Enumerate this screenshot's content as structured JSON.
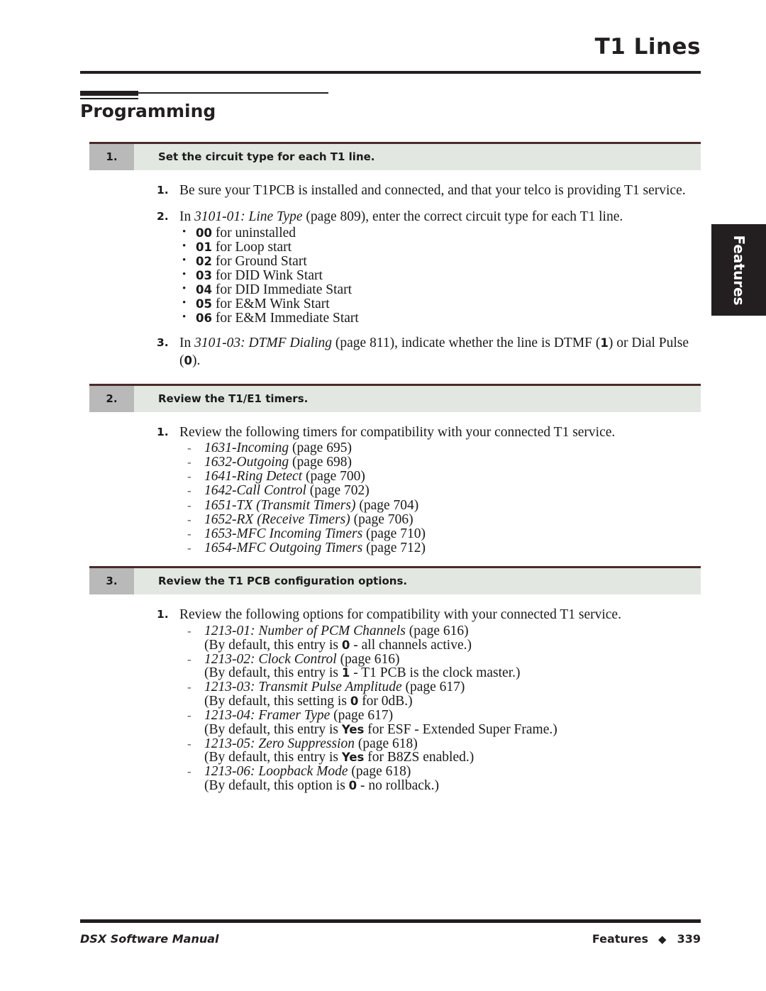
{
  "header": {
    "title": "T1 Lines"
  },
  "section_heading": {
    "title": "Programming"
  },
  "side_tab": {
    "label": "Features"
  },
  "steps": [
    {
      "number": "1.",
      "title": "Set the circuit type for each T1 line.",
      "substeps": [
        {
          "marker": "1.",
          "text": "Be sure your T1PCB is installed and connected, and that your telco is providing T1 service."
        },
        {
          "marker": "2.",
          "text_pre": "In ",
          "text_italic": "3101-01: Line Type",
          "text_post": " (page 809), enter the correct circuit type for each T1 line.",
          "bullets": [
            {
              "code": "00",
              "text": " for uninstalled"
            },
            {
              "code": "01",
              "text": " for Loop start"
            },
            {
              "code": "02",
              "text": " for Ground Start"
            },
            {
              "code": "03",
              "text": " for DID Wink Start"
            },
            {
              "code": "04",
              "text": " for DID Immediate Start"
            },
            {
              "code": "05",
              "text": " for E&M Wink Start"
            },
            {
              "code": "06",
              "text": " for E&M Immediate Start"
            }
          ]
        },
        {
          "marker": "3.",
          "text_pre": "In ",
          "text_italic": "3101-03: DTMF Dialing",
          "text_mid": " (page 811), indicate whether the line is DTMF (",
          "code_a": "1",
          "text_mid2": ") or Dial Pulse (",
          "code_b": "0",
          "text_post": ")."
        }
      ]
    },
    {
      "number": "2.",
      "title": "Review the T1/E1 timers.",
      "substeps": [
        {
          "marker": "1.",
          "text": "Review the following timers for compatibility with your connected T1 service.",
          "dashes": [
            {
              "italic": "1631-Incoming",
              "plain": " (page 695)"
            },
            {
              "italic": "1632-Outgoing",
              "plain": " (page 698)"
            },
            {
              "italic": "1641-Ring Detect",
              "plain": " (page 700)"
            },
            {
              "italic": "1642-Call Control",
              "plain": " (page 702)"
            },
            {
              "italic": "1651-TX (Transmit Timers)",
              "plain": " (page 704)"
            },
            {
              "italic": "1652-RX (Receive Timers)",
              "plain": " (page 706)"
            },
            {
              "italic": "1653-MFC Incoming Timers",
              "plain": " (page 710)"
            },
            {
              "italic": "1654-MFC Outgoing Timers",
              "plain": " (page 712)"
            }
          ]
        }
      ]
    },
    {
      "number": "3.",
      "title": "Review the T1 PCB configuration options.",
      "substeps": [
        {
          "marker": "1.",
          "text": "Review the following options for compatibility with your connected T1 service.",
          "dashes": [
            {
              "italic": "1213-01: Number of PCM Channels",
              "plain": " (page 616)",
              "note_pre": "(By default, this entry is ",
              "note_code": "0",
              "note_post": " - all channels active.)"
            },
            {
              "italic": "1213-02: Clock Control",
              "plain": " (page 616)",
              "note_pre": "(By default, this entry is ",
              "note_code": "1",
              "note_post": " - T1 PCB is the clock master.)"
            },
            {
              "italic": "1213-03: Transmit Pulse Amplitude",
              "plain": " (page 617)",
              "note_pre": "(By default, this setting is ",
              "note_code": "0",
              "note_post": " for 0dB.)"
            },
            {
              "italic": "1213-04: Framer Type",
              "plain": " (page 617)",
              "note_pre": "(By default, this entry is ",
              "note_code": "Yes",
              "note_post": " for ESF - Extended Super Frame.)"
            },
            {
              "italic": "1213-05: Zero Suppression",
              "plain": " (page 618)",
              "note_pre": "(By default, this entry is ",
              "note_code": "Yes",
              "note_post": " for B8ZS enabled.)"
            },
            {
              "italic": "1213-06: Loopback Mode",
              "plain": " (page 618)",
              "note_pre": "(By default, this option is ",
              "note_code": "0",
              "note_post": " - no rollback.)"
            }
          ]
        }
      ]
    }
  ],
  "footer": {
    "manual": "DSX Software Manual",
    "section": "Features",
    "diamond": "◆",
    "page": "339"
  },
  "colors": {
    "ink": "#231f20",
    "step_number_bg": "#b9b9b9",
    "step_label_bg": "#e2e8e1",
    "step_top_border": "#4a2b2b",
    "tab_bg": "#231f20"
  }
}
